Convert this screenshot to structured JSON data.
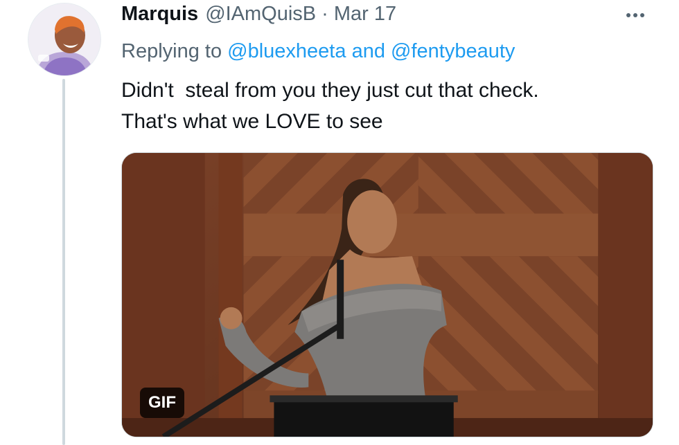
{
  "author": {
    "name": "Marquis",
    "handle": "@IAmQuisB",
    "separator": "·",
    "date": "Mar 17",
    "avatar_icon": "user-avatar"
  },
  "reply_context": {
    "prefix": "Replying to",
    "mention1": "@bluexheeta",
    "conjunction": "and",
    "mention2": "@fentybeauty"
  },
  "tweet": {
    "line1": "Didn't  steal from you they just cut that check.",
    "line2": "That's what we LOVE to see"
  },
  "media": {
    "type": "gif",
    "badge_label": "GIF"
  },
  "colors": {
    "link": "#1d9bf0",
    "secondary_text": "#536471",
    "thread_line": "#cfd9de"
  },
  "icons": {
    "more": "more-horizontal-icon"
  }
}
